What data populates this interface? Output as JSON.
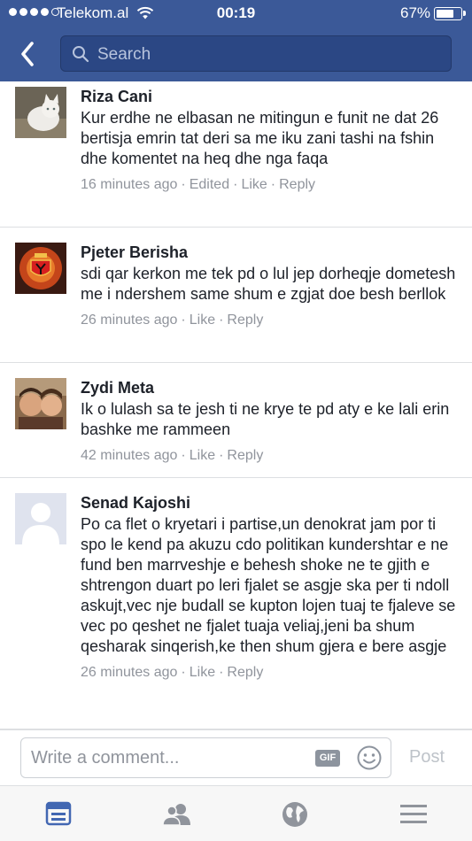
{
  "status_bar": {
    "carrier": "Telekom.al",
    "time": "00:19",
    "battery": "67%"
  },
  "search": {
    "placeholder": "Search"
  },
  "comments": [
    {
      "name": "Riza Cani",
      "text": "Kur erdhe ne elbasan ne mitingun e funit ne dat 26 bertisja emrin tat deri sa me iku zani tashi na fshin dhe komentet  na heq dhe nga faqa",
      "time": "16 minutes ago",
      "edited": "Edited",
      "like": "Like",
      "reply": "Reply"
    },
    {
      "name": "Pjeter Berisha",
      "text": "sdi qar kerkon me tek pd o lul jep dorheqje dometesh me i ndershem same shum e zgjat doe besh berllok",
      "time": "26 minutes ago",
      "like": "Like",
      "reply": "Reply"
    },
    {
      "name": "Zydi Meta",
      "text": "Ik o lulash sa te jesh ti ne krye te pd aty e ke lali erin bashke me rammeen",
      "time": "42 minutes ago",
      "like": "Like",
      "reply": "Reply"
    },
    {
      "name": "Senad Kajoshi",
      "text": "Po ca flet o kryetari i partise,un denokrat jam por ti spo le kend pa akuzu cdo politikan kundershtar e ne fund ben marrveshje e behesh shoke ne te gjith e shtrengon duart po leri fjalet se asgje ska per ti ndoll askujt,vec nje budall se kupton lojen tuaj te fjaleve se vec po qeshet ne fjalet tuaja veliaj,jeni ba shum qesharak sinqerish,ke then shum gjera e bere asgje",
      "time": "26 minutes ago",
      "like": "Like",
      "reply": "Reply"
    }
  ],
  "composer": {
    "placeholder": "Write a comment...",
    "gif_label": "GIF",
    "post_label": "Post"
  },
  "tabs": [
    "news-feed-icon",
    "friends-icon",
    "globe-icon",
    "menu-icon"
  ],
  "colors": {
    "header": "#3b5998",
    "active_tab": "#4267b2",
    "inactive_tab": "#90949c"
  }
}
